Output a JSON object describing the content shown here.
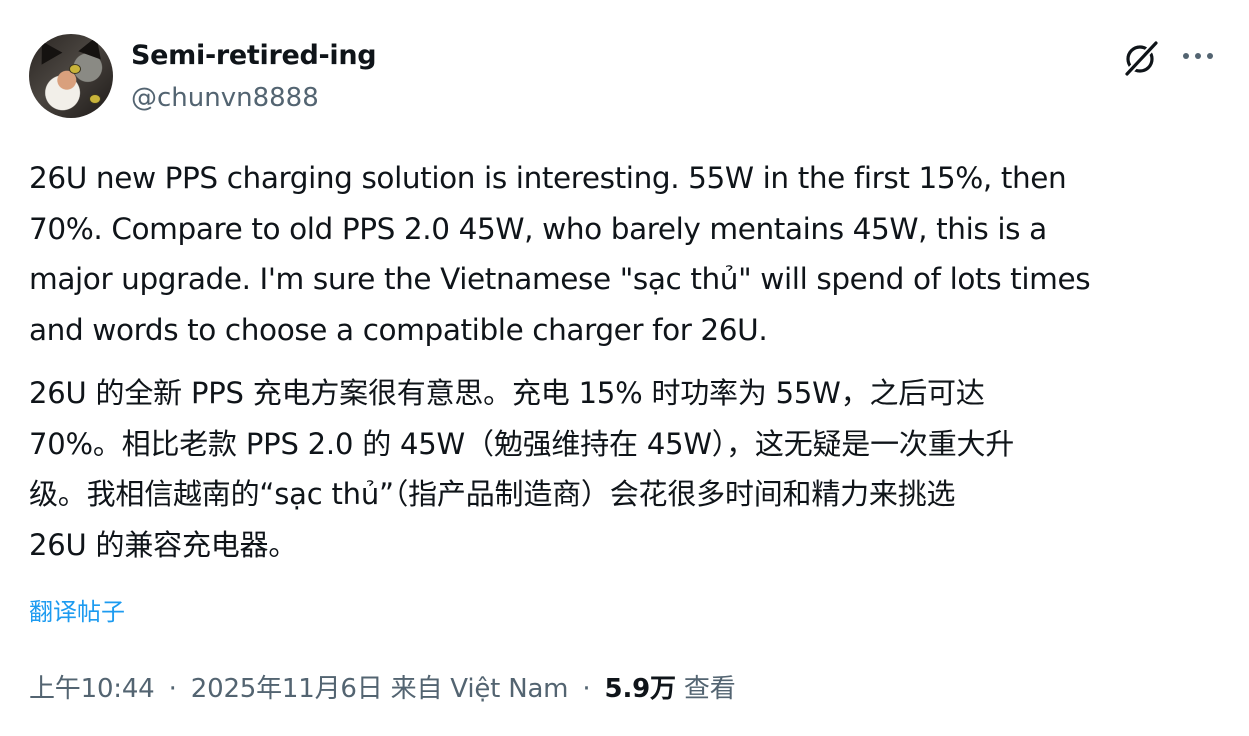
{
  "author": {
    "display_name": "Semi-retired-ing",
    "handle": "@chunvn8888",
    "avatar_icon": "cat-avatar"
  },
  "actions": {
    "grok_icon": "grok-icon",
    "more_icon": "more-icon"
  },
  "post": {
    "text_en": "26U new PPS charging solution is interesting. 55W in the first 15%, then\n70%. Compare to old PPS 2.0 45W, who barely mentains 45W, this is a\nmajor upgrade. I'm sure the Vietnamese \"sạc thủ\" will spend of lots times\nand words to choose a compatible charger for 26U.",
    "text_zh": "26U 的全新 PPS 充电方案很有意思。充电 15% 时功率为 55W，之后可达\n70%。相比老款 PPS 2.0 的 45W（勉强维持在 45W），这无疑是一次重大升\n级。我相信越南的“sạc thủ”（指产品制造商）会花很多时间和精力来挑选\n26U 的兼容充电器。",
    "translate_label": "翻译帖子"
  },
  "meta": {
    "time": "上午10:44",
    "date": "2025年11月6日",
    "source": "来自 Việt Nam",
    "views_count": "5.9万",
    "views_label": "查看",
    "separator": "·"
  },
  "colors": {
    "text_primary": "#0f1419",
    "text_secondary": "#536471",
    "link": "#1d9bf0",
    "background": "#ffffff"
  }
}
